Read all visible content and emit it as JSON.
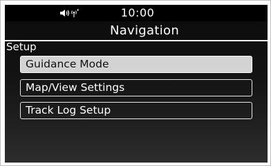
{
  "status": {
    "time": "10:00",
    "icons": [
      "speaker-volume-icon",
      "signal-antenna-icon"
    ]
  },
  "screen": {
    "title": "Navigation",
    "section": "Setup"
  },
  "menu": {
    "items": [
      {
        "label": "Guidance Mode",
        "selected": true
      },
      {
        "label": "Map/View Settings",
        "selected": false
      },
      {
        "label": "Track Log Setup",
        "selected": false
      }
    ]
  },
  "colors": {
    "screen_background": "#0b0b0b",
    "text": "#ffffff",
    "selected_background": "#d3d3d3",
    "selected_text": "#111111",
    "item_border": "#e8e8e8"
  }
}
